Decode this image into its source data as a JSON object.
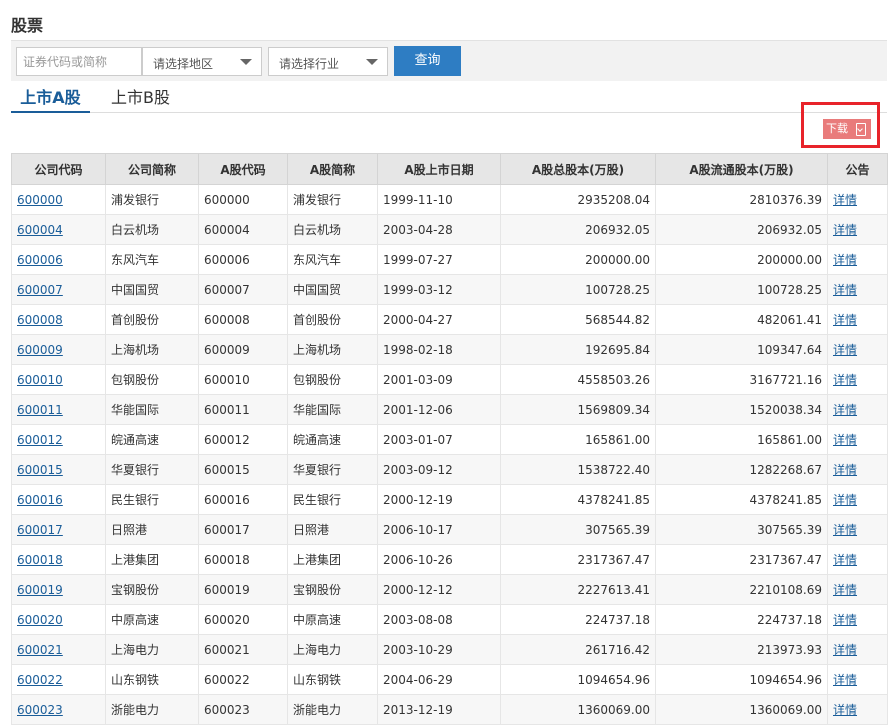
{
  "page": {
    "title": "股票"
  },
  "filters": {
    "search_placeholder": "证券代码或简称",
    "region_placeholder": "请选择地区",
    "industry_placeholder": "请选择行业",
    "query_label": "查询"
  },
  "tabs": [
    {
      "label": "上市A股",
      "active": true
    },
    {
      "label": "上市B股",
      "active": false
    }
  ],
  "download": {
    "label": "下载"
  },
  "table": {
    "headers": [
      "公司代码",
      "公司简称",
      "A股代码",
      "A股简称",
      "A股上市日期",
      "A股总股本(万股)",
      "A股流通股本(万股)",
      "公告"
    ],
    "rows": [
      [
        "600000",
        "浦发银行",
        "600000",
        "浦发银行",
        "1999-11-10",
        "2935208.04",
        "2810376.39",
        "详情"
      ],
      [
        "600004",
        "白云机场",
        "600004",
        "白云机场",
        "2003-04-28",
        "206932.05",
        "206932.05",
        "详情"
      ],
      [
        "600006",
        "东风汽车",
        "600006",
        "东风汽车",
        "1999-07-27",
        "200000.00",
        "200000.00",
        "详情"
      ],
      [
        "600007",
        "中国国贸",
        "600007",
        "中国国贸",
        "1999-03-12",
        "100728.25",
        "100728.25",
        "详情"
      ],
      [
        "600008",
        "首创股份",
        "600008",
        "首创股份",
        "2000-04-27",
        "568544.82",
        "482061.41",
        "详情"
      ],
      [
        "600009",
        "上海机场",
        "600009",
        "上海机场",
        "1998-02-18",
        "192695.84",
        "109347.64",
        "详情"
      ],
      [
        "600010",
        "包钢股份",
        "600010",
        "包钢股份",
        "2001-03-09",
        "4558503.26",
        "3167721.16",
        "详情"
      ],
      [
        "600011",
        "华能国际",
        "600011",
        "华能国际",
        "2001-12-06",
        "1569809.34",
        "1520038.34",
        "详情"
      ],
      [
        "600012",
        "皖通高速",
        "600012",
        "皖通高速",
        "2003-01-07",
        "165861.00",
        "165861.00",
        "详情"
      ],
      [
        "600015",
        "华夏银行",
        "600015",
        "华夏银行",
        "2003-09-12",
        "1538722.40",
        "1282268.67",
        "详情"
      ],
      [
        "600016",
        "民生银行",
        "600016",
        "民生银行",
        "2000-12-19",
        "4378241.85",
        "4378241.85",
        "详情"
      ],
      [
        "600017",
        "日照港",
        "600017",
        "日照港",
        "2006-10-17",
        "307565.39",
        "307565.39",
        "详情"
      ],
      [
        "600018",
        "上港集团",
        "600018",
        "上港集团",
        "2006-10-26",
        "2317367.47",
        "2317367.47",
        "详情"
      ],
      [
        "600019",
        "宝钢股份",
        "600019",
        "宝钢股份",
        "2000-12-12",
        "2227613.41",
        "2210108.69",
        "详情"
      ],
      [
        "600020",
        "中原高速",
        "600020",
        "中原高速",
        "2003-08-08",
        "224737.18",
        "224737.18",
        "详情"
      ],
      [
        "600021",
        "上海电力",
        "600021",
        "上海电力",
        "2003-10-29",
        "261716.42",
        "213973.93",
        "详情"
      ],
      [
        "600022",
        "山东钢铁",
        "600022",
        "山东钢铁",
        "2004-06-29",
        "1094654.96",
        "1094654.96",
        "详情"
      ],
      [
        "600023",
        "浙能电力",
        "600023",
        "浙能电力",
        "2013-12-19",
        "1360069.00",
        "1360069.00",
        "详情"
      ]
    ]
  }
}
